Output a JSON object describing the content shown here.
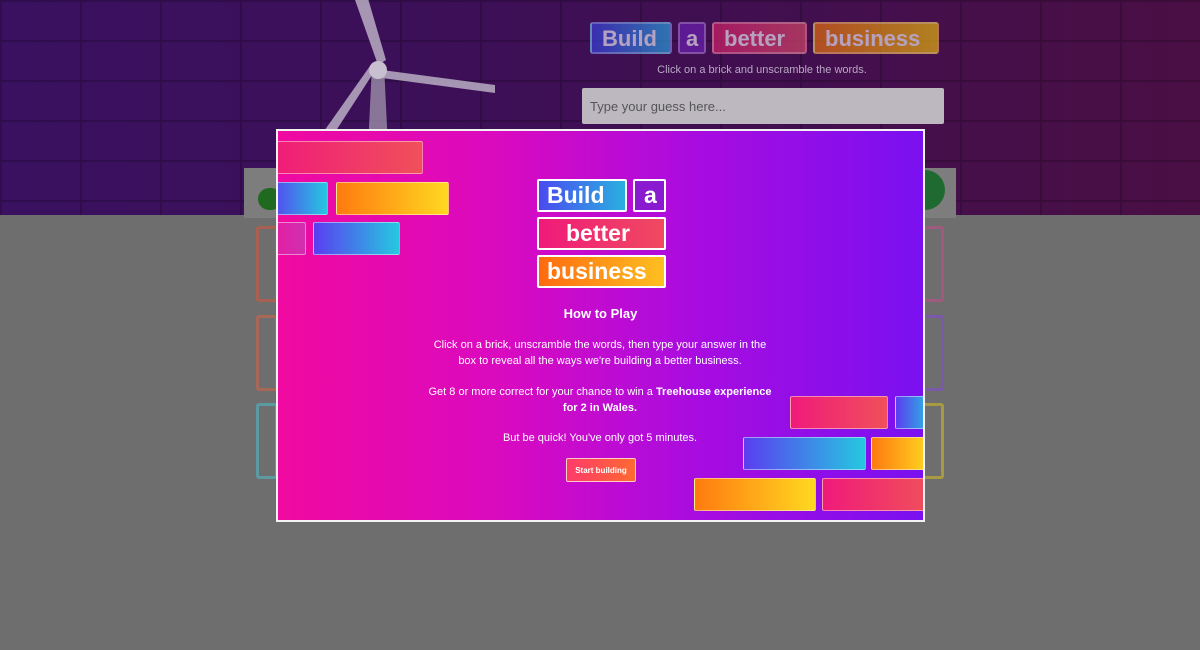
{
  "header": {
    "title_words": [
      "Build",
      "a",
      "better",
      "business"
    ],
    "hint": "Click on a brick and unscramble the words.",
    "guess_placeholder": "Type your guess here..."
  },
  "modal": {
    "logo_words": [
      "Build",
      "a",
      "better",
      "business"
    ],
    "heading": "How to Play",
    "instructions": "Click on a brick, unscramble the words, then type your answer in the box to reveal all the ways we're building a better business.",
    "prize_prefix": "Get 8 or more correct for your chance to win a ",
    "prize_bold": "Treehouse experience for 2 in Wales.",
    "time_note": "But be quick! You've only got 5 minutes.",
    "start_label": "Start building"
  },
  "colors": {
    "modal_gradient_start": "#f00aa0",
    "modal_gradient_end": "#7a10f0",
    "start_button": "#ff4a50"
  },
  "icons": [
    "wind-turbine-icon"
  ]
}
